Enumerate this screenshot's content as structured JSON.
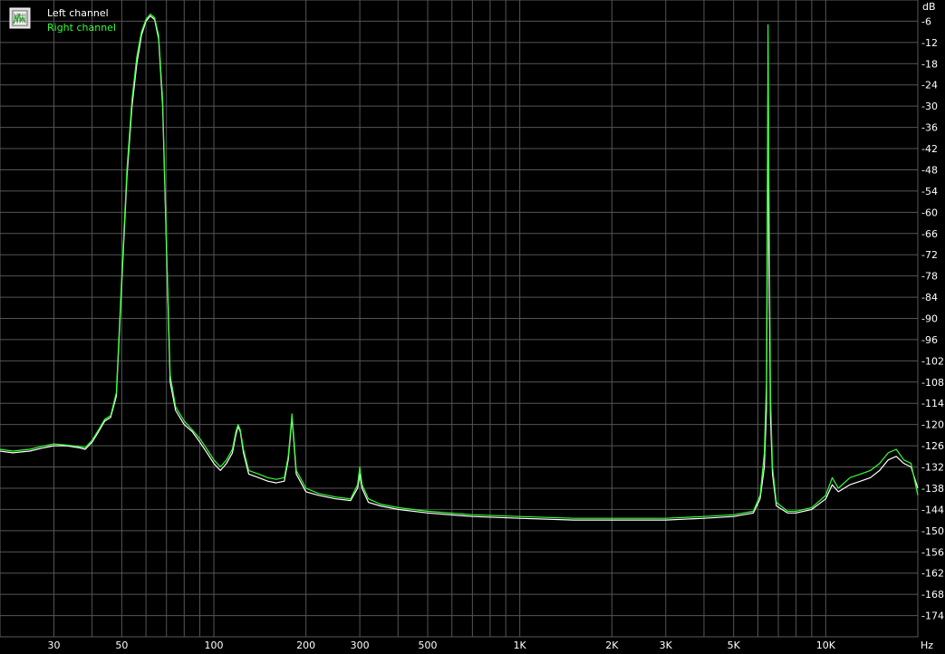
{
  "chart_data": {
    "type": "line",
    "x_scale": "log",
    "xlim": [
      20,
      20000
    ],
    "ylim": [
      -180,
      0
    ],
    "grid": true,
    "y_unit": "dB",
    "x_unit": "Hz",
    "legend_position": "top-left",
    "x_ticks": [
      {
        "value": 30,
        "label": "30"
      },
      {
        "value": 50,
        "label": "50"
      },
      {
        "value": 100,
        "label": "100"
      },
      {
        "value": 200,
        "label": "200"
      },
      {
        "value": 300,
        "label": "300"
      },
      {
        "value": 500,
        "label": "500"
      },
      {
        "value": 1000,
        "label": "1K"
      },
      {
        "value": 2000,
        "label": "2K"
      },
      {
        "value": 3000,
        "label": "3K"
      },
      {
        "value": 5000,
        "label": "5K"
      },
      {
        "value": 10000,
        "label": "10K"
      }
    ],
    "y_ticks": [
      -6,
      -12,
      -18,
      -24,
      -30,
      -36,
      -42,
      -48,
      -54,
      -60,
      -66,
      -72,
      -78,
      -84,
      -90,
      -96,
      -102,
      -108,
      -114,
      -120,
      -126,
      -132,
      -138,
      -144,
      -150,
      -156,
      -162,
      -168,
      -174
    ],
    "series": [
      {
        "name": "Left channel",
        "color": "#ffffff",
        "points": [
          [
            20,
            -127.5
          ],
          [
            22,
            -128
          ],
          [
            25,
            -127.5
          ],
          [
            28,
            -126.5
          ],
          [
            30,
            -126
          ],
          [
            33,
            -126
          ],
          [
            36,
            -126.5
          ],
          [
            38,
            -127
          ],
          [
            40,
            -125
          ],
          [
            42,
            -122
          ],
          [
            44,
            -119
          ],
          [
            46,
            -118
          ],
          [
            48,
            -112
          ],
          [
            50,
            -80
          ],
          [
            52,
            -50
          ],
          [
            54,
            -30
          ],
          [
            56,
            -18
          ],
          [
            58,
            -10
          ],
          [
            60,
            -6
          ],
          [
            62,
            -4.5
          ],
          [
            64,
            -5.5
          ],
          [
            66,
            -11
          ],
          [
            68,
            -30
          ],
          [
            70,
            -70
          ],
          [
            72,
            -108
          ],
          [
            75,
            -116
          ],
          [
            80,
            -120
          ],
          [
            85,
            -122
          ],
          [
            90,
            -125
          ],
          [
            95,
            -128
          ],
          [
            100,
            -131
          ],
          [
            105,
            -133
          ],
          [
            110,
            -131
          ],
          [
            115,
            -128
          ],
          [
            118,
            -123
          ],
          [
            120,
            -120.5
          ],
          [
            122,
            -122
          ],
          [
            125,
            -128
          ],
          [
            130,
            -134
          ],
          [
            140,
            -135
          ],
          [
            150,
            -136
          ],
          [
            160,
            -136.5
          ],
          [
            170,
            -136
          ],
          [
            175,
            -130
          ],
          [
            178,
            -123
          ],
          [
            180,
            -118
          ],
          [
            182,
            -123
          ],
          [
            186,
            -134
          ],
          [
            200,
            -139
          ],
          [
            220,
            -140
          ],
          [
            250,
            -141
          ],
          [
            280,
            -141.5
          ],
          [
            295,
            -138
          ],
          [
            300,
            -134
          ],
          [
            305,
            -138
          ],
          [
            320,
            -142
          ],
          [
            350,
            -143
          ],
          [
            400,
            -144
          ],
          [
            500,
            -145
          ],
          [
            700,
            -146
          ],
          [
            1000,
            -146.5
          ],
          [
            1500,
            -147
          ],
          [
            2000,
            -147
          ],
          [
            3000,
            -147
          ],
          [
            4000,
            -146.5
          ],
          [
            5000,
            -146
          ],
          [
            5800,
            -145
          ],
          [
            6100,
            -141
          ],
          [
            6300,
            -132
          ],
          [
            6400,
            -116
          ],
          [
            6450,
            -70
          ],
          [
            6480,
            -16
          ],
          [
            6520,
            -70
          ],
          [
            6600,
            -118
          ],
          [
            6700,
            -134
          ],
          [
            6900,
            -143
          ],
          [
            7500,
            -145
          ],
          [
            8000,
            -145
          ],
          [
            9000,
            -144
          ],
          [
            10000,
            -141
          ],
          [
            10500,
            -137
          ],
          [
            11000,
            -139
          ],
          [
            12000,
            -137
          ],
          [
            13000,
            -136
          ],
          [
            14000,
            -135
          ],
          [
            15000,
            -133
          ],
          [
            16000,
            -130
          ],
          [
            17000,
            -129
          ],
          [
            18000,
            -131
          ],
          [
            19000,
            -132
          ],
          [
            20000,
            -138
          ]
        ]
      },
      {
        "name": "Right channel",
        "color": "#33ff33",
        "points": [
          [
            20,
            -127
          ],
          [
            22,
            -127.5
          ],
          [
            25,
            -127
          ],
          [
            28,
            -126
          ],
          [
            30,
            -125.5
          ],
          [
            33,
            -125.8
          ],
          [
            36,
            -126.2
          ],
          [
            38,
            -126.5
          ],
          [
            40,
            -124.5
          ],
          [
            42,
            -121.5
          ],
          [
            44,
            -118.5
          ],
          [
            46,
            -117.5
          ],
          [
            48,
            -111
          ],
          [
            50,
            -78
          ],
          [
            52,
            -48
          ],
          [
            54,
            -28
          ],
          [
            56,
            -16
          ],
          [
            58,
            -9
          ],
          [
            60,
            -5.5
          ],
          [
            62,
            -4
          ],
          [
            64,
            -5
          ],
          [
            66,
            -10
          ],
          [
            68,
            -28
          ],
          [
            70,
            -68
          ],
          [
            72,
            -106
          ],
          [
            75,
            -115
          ],
          [
            80,
            -119
          ],
          [
            85,
            -121.5
          ],
          [
            90,
            -124
          ],
          [
            95,
            -127
          ],
          [
            100,
            -130
          ],
          [
            105,
            -132
          ],
          [
            110,
            -130
          ],
          [
            115,
            -127
          ],
          [
            118,
            -122
          ],
          [
            120,
            -120
          ],
          [
            122,
            -121.5
          ],
          [
            125,
            -127
          ],
          [
            130,
            -133
          ],
          [
            140,
            -134
          ],
          [
            150,
            -135
          ],
          [
            160,
            -135.5
          ],
          [
            170,
            -135
          ],
          [
            175,
            -129
          ],
          [
            178,
            -122
          ],
          [
            180,
            -117
          ],
          [
            182,
            -122
          ],
          [
            186,
            -133
          ],
          [
            200,
            -138
          ],
          [
            220,
            -139.5
          ],
          [
            250,
            -140.5
          ],
          [
            280,
            -141
          ],
          [
            295,
            -137
          ],
          [
            300,
            -132
          ],
          [
            305,
            -137
          ],
          [
            320,
            -141
          ],
          [
            350,
            -142.5
          ],
          [
            400,
            -143.5
          ],
          [
            500,
            -144.5
          ],
          [
            700,
            -145.5
          ],
          [
            1000,
            -146
          ],
          [
            1500,
            -146.5
          ],
          [
            2000,
            -146.5
          ],
          [
            3000,
            -146.5
          ],
          [
            4000,
            -146
          ],
          [
            5000,
            -145.5
          ],
          [
            5800,
            -144.5
          ],
          [
            6100,
            -140
          ],
          [
            6300,
            -128
          ],
          [
            6400,
            -108
          ],
          [
            6450,
            -50
          ],
          [
            6480,
            -7
          ],
          [
            6520,
            -50
          ],
          [
            6600,
            -112
          ],
          [
            6700,
            -132
          ],
          [
            6900,
            -142
          ],
          [
            7500,
            -144.5
          ],
          [
            8000,
            -144.5
          ],
          [
            9000,
            -143.5
          ],
          [
            10000,
            -140
          ],
          [
            10500,
            -135
          ],
          [
            11000,
            -138
          ],
          [
            12000,
            -135
          ],
          [
            13000,
            -134
          ],
          [
            14000,
            -133
          ],
          [
            15000,
            -131
          ],
          [
            16000,
            -128
          ],
          [
            17000,
            -127
          ],
          [
            18000,
            -130
          ],
          [
            19000,
            -131
          ],
          [
            20000,
            -140
          ]
        ]
      }
    ]
  }
}
